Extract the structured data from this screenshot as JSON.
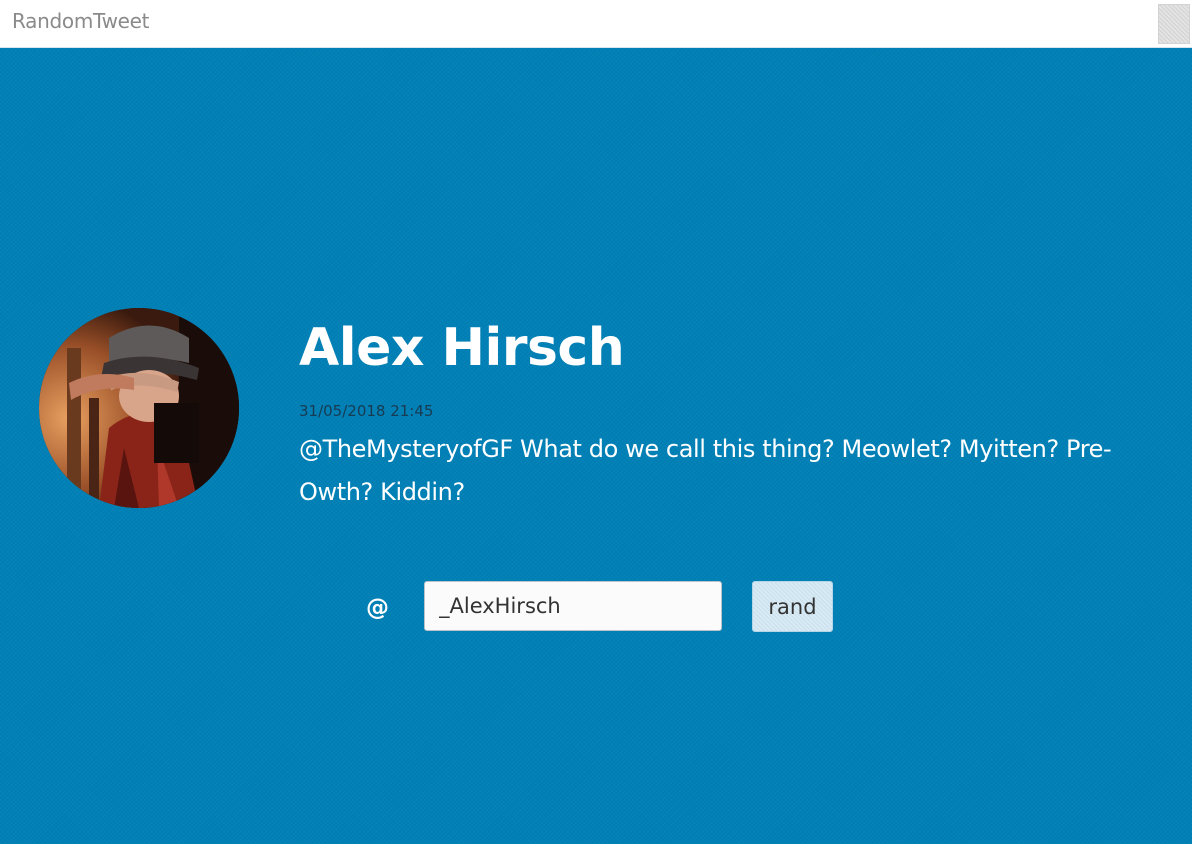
{
  "window": {
    "title": "RandomTweet"
  },
  "tweet": {
    "author_name": "Alex Hirsch",
    "timestamp": "31/05/2018 21:45",
    "text": "@TheMysteryofGF What do we call this thing? Meowlet? Myitten? Pre-Owth? Kiddin?",
    "avatar_icon": "avatar-photo"
  },
  "search": {
    "at_symbol": "@",
    "handle_value": "_AlexHirsch",
    "button_label": "rand"
  },
  "colors": {
    "background": "#0080b6",
    "titlebar": "#ffffff",
    "date_text": "#173b52",
    "button_bg": "#cde4f0"
  }
}
